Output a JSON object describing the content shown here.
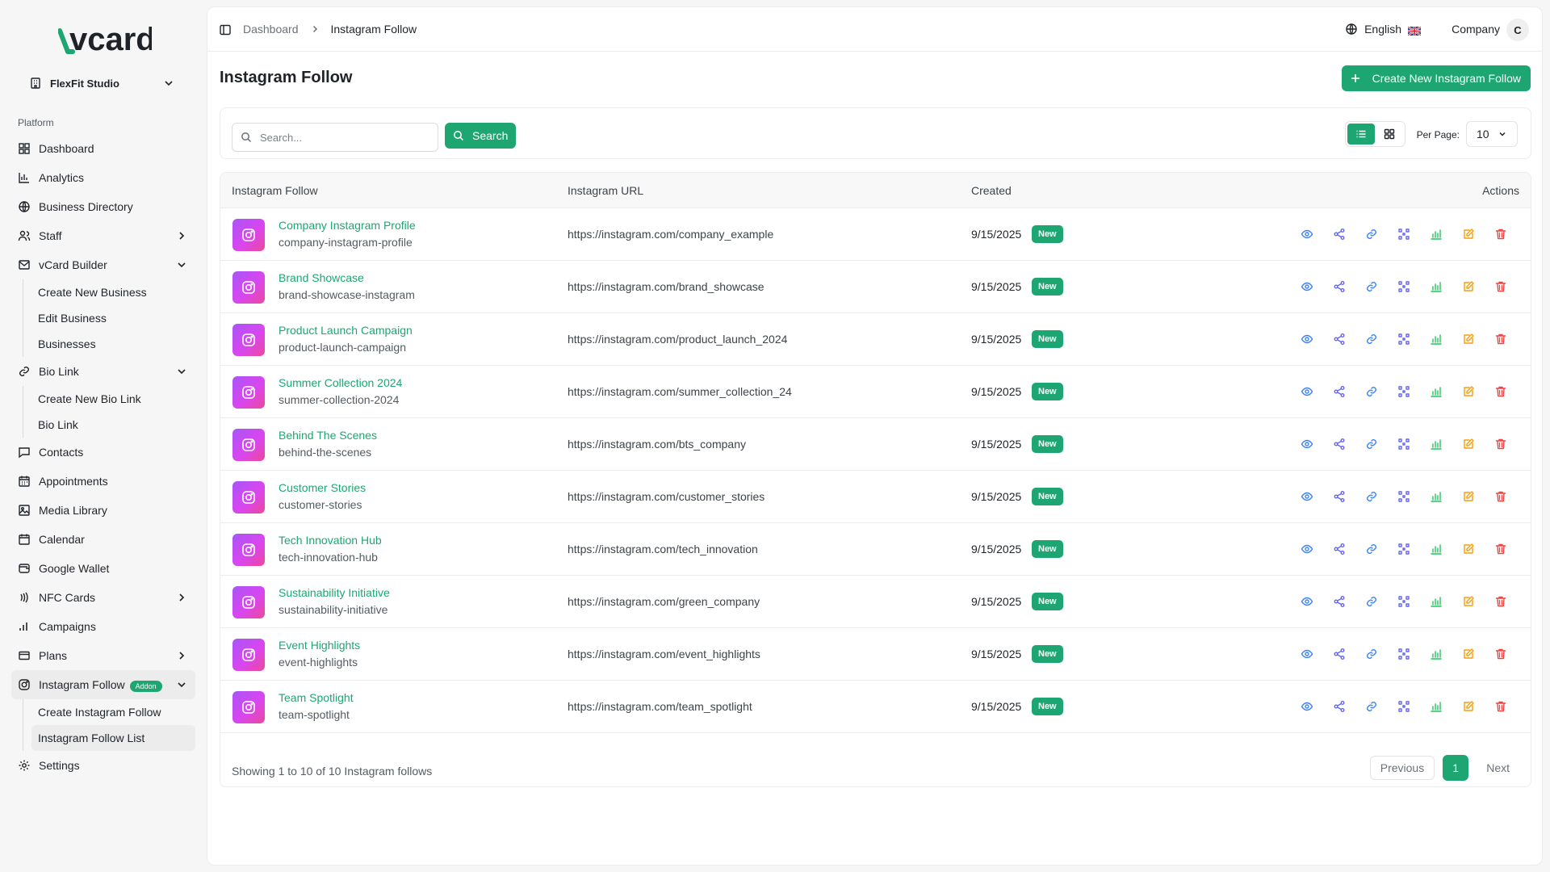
{
  "brand": {
    "logo_text": "vcard",
    "accent": "#1ea672"
  },
  "workspace": {
    "name": "FlexFit Studio",
    "icon": "building-icon"
  },
  "sidebar": {
    "section_label": "Platform",
    "items": [
      {
        "label": "Dashboard",
        "icon": "grid-icon"
      },
      {
        "label": "Analytics",
        "icon": "bar-chart-icon"
      },
      {
        "label": "Business Directory",
        "icon": "globe-icon"
      },
      {
        "label": "Staff",
        "icon": "users-icon",
        "chevron": "right"
      },
      {
        "label": "vCard Builder",
        "icon": "mail-icon",
        "chevron": "down",
        "children": [
          "Create New Business",
          "Edit Business",
          "Businesses"
        ]
      },
      {
        "label": "Bio Link",
        "icon": "link-icon",
        "chevron": "down",
        "children": [
          "Create New Bio Link",
          "Bio Link"
        ]
      },
      {
        "label": "Contacts",
        "icon": "chat-icon"
      },
      {
        "label": "Appointments",
        "icon": "calendar-clock-icon"
      },
      {
        "label": "Media Library",
        "icon": "image-icon"
      },
      {
        "label": "Calendar",
        "icon": "calendar-icon"
      },
      {
        "label": "Google Wallet",
        "icon": "wallet-icon"
      },
      {
        "label": "NFC Cards",
        "icon": "nfc-icon",
        "chevron": "right"
      },
      {
        "label": "Campaigns",
        "icon": "signal-icon"
      },
      {
        "label": "Plans",
        "icon": "card-icon",
        "chevron": "right"
      },
      {
        "label": "Instagram Follow",
        "icon": "instagram-icon",
        "chevron": "down",
        "badge": "Addon",
        "active": true,
        "children": [
          "Create Instagram Follow",
          "Instagram Follow List"
        ],
        "active_child": 1
      },
      {
        "label": "Settings",
        "icon": "gear-icon"
      }
    ]
  },
  "topbar": {
    "breadcrumb": [
      "Dashboard",
      "Instagram Follow"
    ],
    "language": "English",
    "company": "Company",
    "avatar_initial": "C"
  },
  "page": {
    "title": "Instagram Follow",
    "create_label": "Create New Instagram Follow",
    "search_placeholder": "Search...",
    "search_label": "Search",
    "per_page_label": "Per Page:",
    "per_page_value": "10"
  },
  "table": {
    "headers": [
      "Instagram Follow",
      "Instagram URL",
      "Created",
      "Actions"
    ],
    "badge_label": "New",
    "rows": [
      {
        "title": "Company Instagram Profile",
        "slug": "company-instagram-profile",
        "url": "https://instagram.com/company_example",
        "created": "9/15/2025"
      },
      {
        "title": "Brand Showcase",
        "slug": "brand-showcase-instagram",
        "url": "https://instagram.com/brand_showcase",
        "created": "9/15/2025"
      },
      {
        "title": "Product Launch Campaign",
        "slug": "product-launch-campaign",
        "url": "https://instagram.com/product_launch_2024",
        "created": "9/15/2025"
      },
      {
        "title": "Summer Collection 2024",
        "slug": "summer-collection-2024",
        "url": "https://instagram.com/summer_collection_24",
        "created": "9/15/2025"
      },
      {
        "title": "Behind The Scenes",
        "slug": "behind-the-scenes",
        "url": "https://instagram.com/bts_company",
        "created": "9/15/2025"
      },
      {
        "title": "Customer Stories",
        "slug": "customer-stories",
        "url": "https://instagram.com/customer_stories",
        "created": "9/15/2025"
      },
      {
        "title": "Tech Innovation Hub",
        "slug": "tech-innovation-hub",
        "url": "https://instagram.com/tech_innovation",
        "created": "9/15/2025"
      },
      {
        "title": "Sustainability Initiative",
        "slug": "sustainability-initiative",
        "url": "https://instagram.com/green_company",
        "created": "9/15/2025"
      },
      {
        "title": "Event Highlights",
        "slug": "event-highlights",
        "url": "https://instagram.com/event_highlights",
        "created": "9/15/2025"
      },
      {
        "title": "Team Spotlight",
        "slug": "team-spotlight",
        "url": "https://instagram.com/team_spotlight",
        "created": "9/15/2025"
      }
    ],
    "actions": [
      {
        "name": "view-icon",
        "color": "#3b82f6"
      },
      {
        "name": "share-icon",
        "color": "#6366f1"
      },
      {
        "name": "link-icon",
        "color": "#3b82f6"
      },
      {
        "name": "qr-icon",
        "color": "#6366f1"
      },
      {
        "name": "analytics-icon",
        "color": "#22c55e"
      },
      {
        "name": "edit-icon",
        "color": "#f59e0b"
      },
      {
        "name": "delete-icon",
        "color": "#ef4444"
      }
    ]
  },
  "footer": {
    "showing": "Showing 1 to 10 of 10 Instagram follows",
    "previous": "Previous",
    "page": "1",
    "next": "Next"
  }
}
